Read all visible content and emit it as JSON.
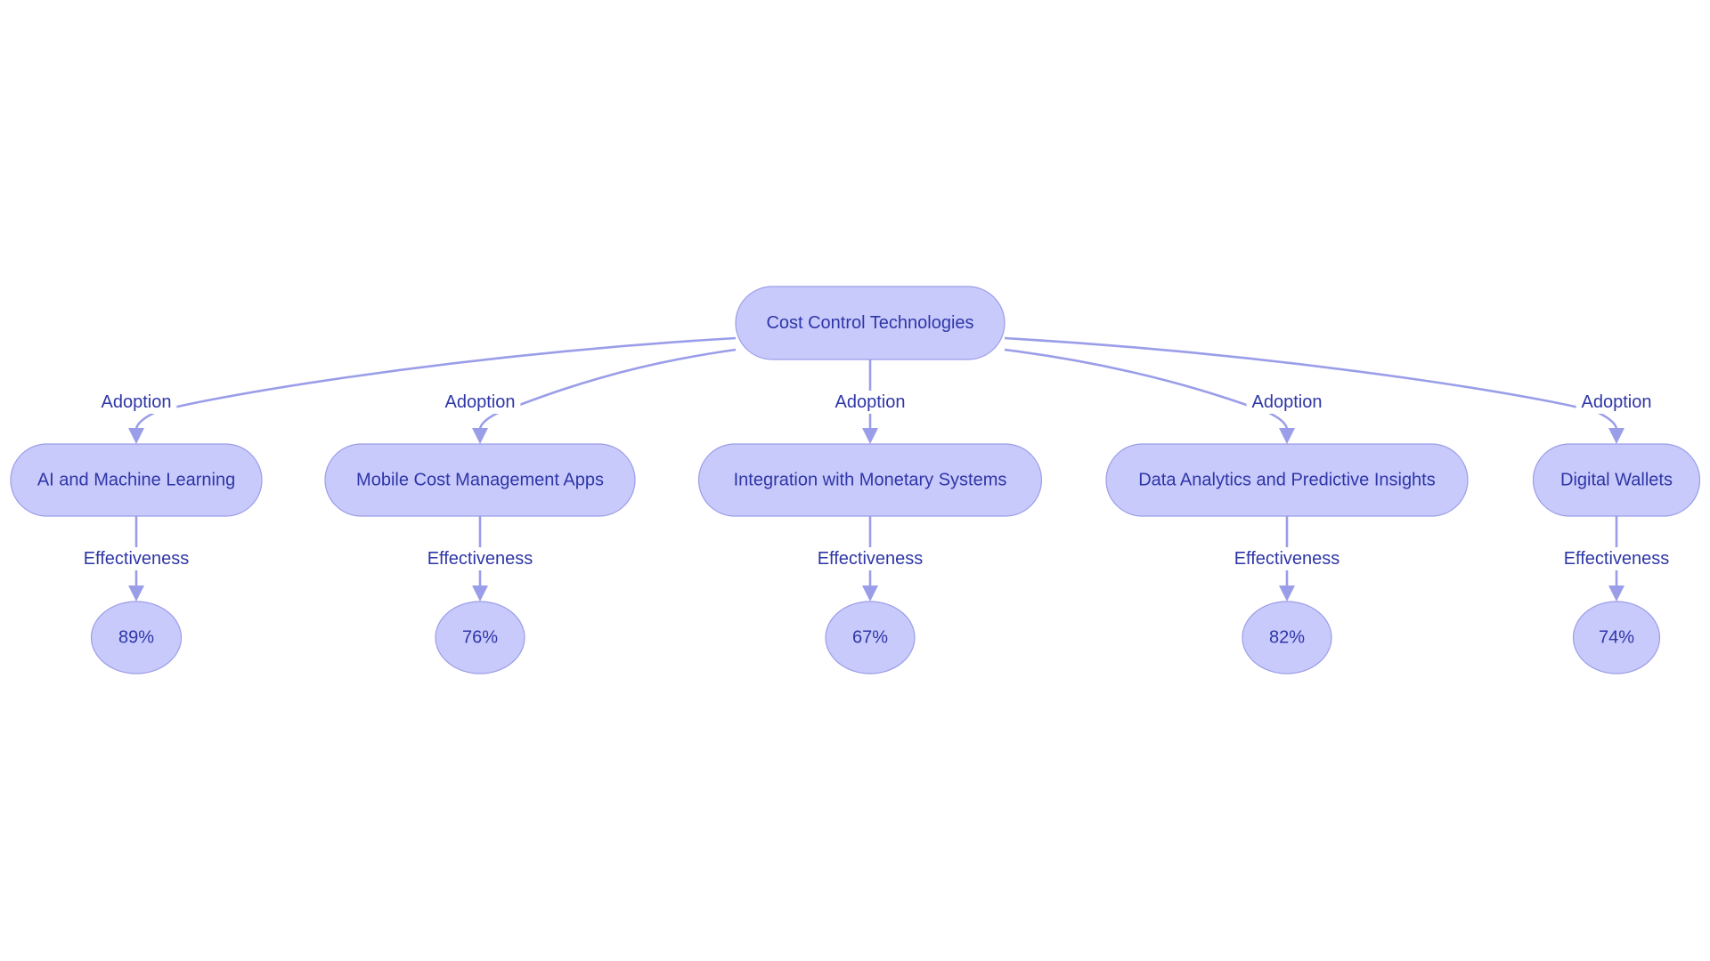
{
  "diagram": {
    "type": "flowchart-top-down",
    "root": {
      "id": "root",
      "label": "Cost Control Technologies"
    },
    "colors": {
      "node_fill": "#c9cafc",
      "node_border": "#9b9de6",
      "edge": "#9a9de8",
      "text": "#2e36a6",
      "background": "#ffffff"
    },
    "branches": [
      {
        "id": "ai",
        "label": "AI and Machine Learning",
        "edge_label": "Adoption",
        "metric_edge_label": "Effectiveness",
        "value": "89%"
      },
      {
        "id": "mobile",
        "label": "Mobile Cost Management Apps",
        "edge_label": "Adoption",
        "metric_edge_label": "Effectiveness",
        "value": "76%"
      },
      {
        "id": "integration",
        "label": "Integration with Monetary Systems",
        "edge_label": "Adoption",
        "metric_edge_label": "Effectiveness",
        "value": "67%"
      },
      {
        "id": "analytics",
        "label": "Data Analytics and Predictive Insights",
        "edge_label": "Adoption",
        "metric_edge_label": "Effectiveness",
        "value": "82%"
      },
      {
        "id": "wallets",
        "label": "Digital Wallets",
        "edge_label": "Adoption",
        "metric_edge_label": "Effectiveness",
        "value": "74%"
      }
    ]
  }
}
